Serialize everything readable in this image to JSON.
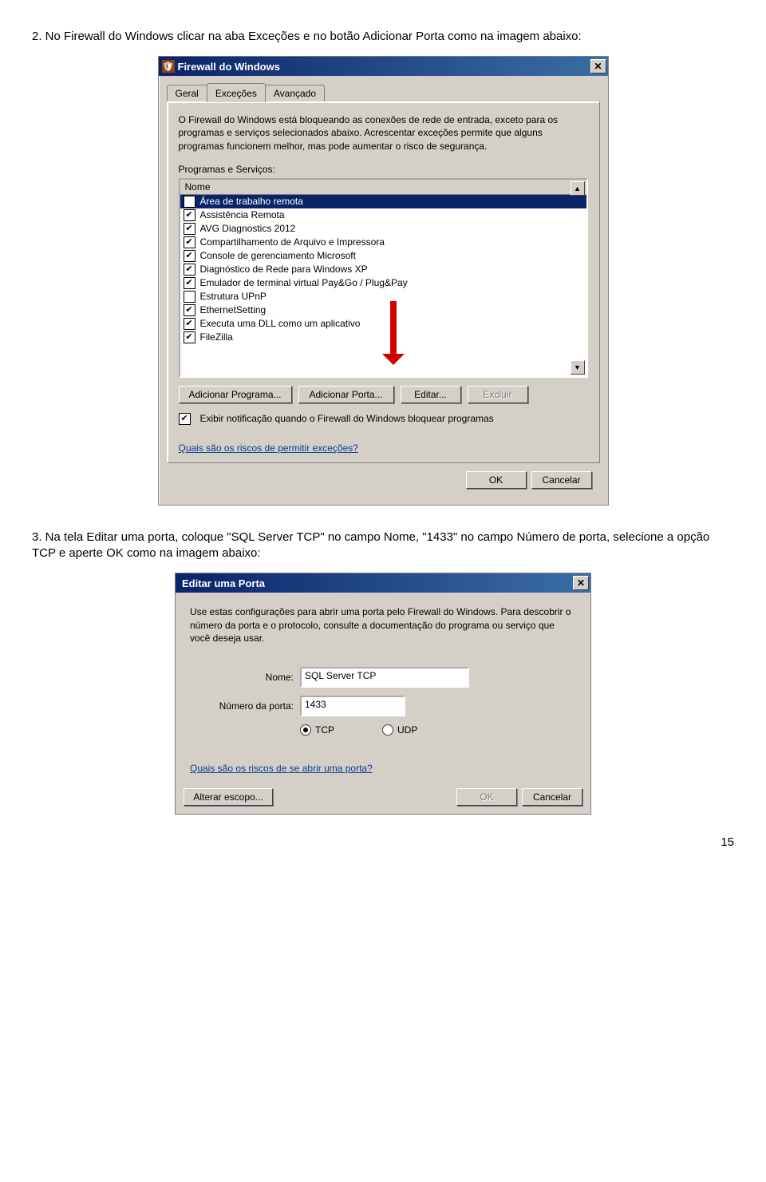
{
  "step2": "2. No Firewall do Windows clicar na aba Exceções e no botão Adicionar Porta como na imagem abaixo:",
  "step3": "3. Na tela Editar uma porta, coloque \"SQL Server TCP\" no campo Nome, \"1433\" no campo Número de porta, selecione a opção TCP e aperte OK como na imagem abaixo:",
  "page_number": "15",
  "dialog1": {
    "title": "Firewall do Windows",
    "tabs": {
      "geral": "Geral",
      "excecoes": "Exceções",
      "avancado": "Avançado"
    },
    "description": "O Firewall do Windows está bloqueando as conexões de rede de entrada, exceto para os programas e serviços selecionados abaixo. Acrescentar exceções permite que alguns programas funcionem melhor, mas pode aumentar o risco de segurança.",
    "list_label": "Programas e Serviços:",
    "header": "Nome",
    "items": [
      {
        "c": true,
        "t": "Área de trabalho remota",
        "sel": true
      },
      {
        "c": true,
        "t": "Assistência Remota"
      },
      {
        "c": true,
        "t": "AVG Diagnostics 2012"
      },
      {
        "c": true,
        "t": "Compartilhamento de Arquivo e Impressora"
      },
      {
        "c": true,
        "t": "Console de gerenciamento Microsoft"
      },
      {
        "c": true,
        "t": "Diagnóstico de Rede para Windows XP"
      },
      {
        "c": true,
        "t": "Emulador de terminal virtual Pay&Go / Plug&Pay"
      },
      {
        "c": false,
        "t": "Estrutura UPnP"
      },
      {
        "c": true,
        "t": "EthernetSetting"
      },
      {
        "c": true,
        "t": "Executa uma DLL como um aplicativo"
      },
      {
        "c": true,
        "t": "FileZilla"
      }
    ],
    "btn_add_prog": "Adicionar Programa...",
    "btn_add_port": "Adicionar Porta...",
    "btn_edit": "Editar...",
    "btn_delete": "Excluir",
    "notify": "Exibir notificação quando o Firewall do Windows bloquear programas",
    "risks_link": "Quais são os riscos de permitir exceções?",
    "ok": "OK",
    "cancel": "Cancelar"
  },
  "dialog2": {
    "title": "Editar uma Porta",
    "description": "Use estas configurações para abrir uma porta pelo Firewall do Windows. Para descobrir o número da porta e o protocolo, consulte a documentação do programa ou serviço que você deseja usar.",
    "name_label": "Nome:",
    "name_value": "SQL Server TCP",
    "port_label": "Número da porta:",
    "port_value": "1433",
    "tcp": "TCP",
    "udp": "UDP",
    "risks_link": "Quais são os riscos de se abrir uma porta?",
    "btn_scope": "Alterar escopo...",
    "ok": "OK",
    "cancel": "Cancelar"
  }
}
